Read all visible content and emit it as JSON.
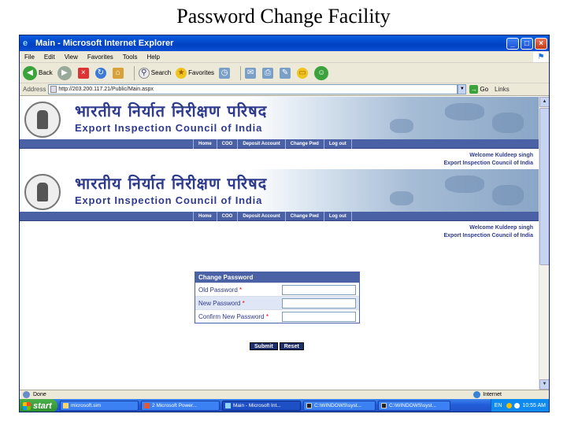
{
  "slide_title": "Password Change Facility",
  "window": {
    "title": "Main - Microsoft Internet Explorer",
    "controls": {
      "minimize": "_",
      "maximize": "□",
      "close": "×"
    }
  },
  "menu": [
    "File",
    "Edit",
    "View",
    "Favorites",
    "Tools",
    "Help"
  ],
  "toolbar": {
    "back": "Back",
    "search": "Search",
    "favorites": "Favorites"
  },
  "address": {
    "label": "Address",
    "url": "http://203.200.117.21/Public/Main.aspx",
    "go": "Go",
    "links": "Links"
  },
  "banner": {
    "hindi_title": "भारतीय निर्यात निरीक्षण परिषद",
    "english_title": "Export Inspection Council of India"
  },
  "nav": [
    "Home",
    "COO",
    "Deposit Account",
    "Change Pwd",
    "Log out"
  ],
  "welcome": {
    "line1": "Welcome Kuldeep singh",
    "line2": "Export Inspection Council of India"
  },
  "form": {
    "heading": "Change Password",
    "fields": [
      {
        "label": "Old Password",
        "required": "*"
      },
      {
        "label": "New Password",
        "required": "*"
      },
      {
        "label": "Confirm New Password",
        "required": "*"
      }
    ],
    "submit": "Submit",
    "reset": "Reset"
  },
  "status": {
    "left": "Done",
    "zone": "Internet"
  },
  "taskbar": {
    "start": "start",
    "tasks": [
      {
        "label": "microsoft.sim"
      },
      {
        "label": "2 Microsoft Power..."
      },
      {
        "label": "Main - Microsoft Int..."
      },
      {
        "label": "C:\\WINDOWS\\syst..."
      },
      {
        "label": "C:\\WINDOWS\\syst..."
      }
    ],
    "lang": "EN",
    "clock": "10:55 AM"
  }
}
